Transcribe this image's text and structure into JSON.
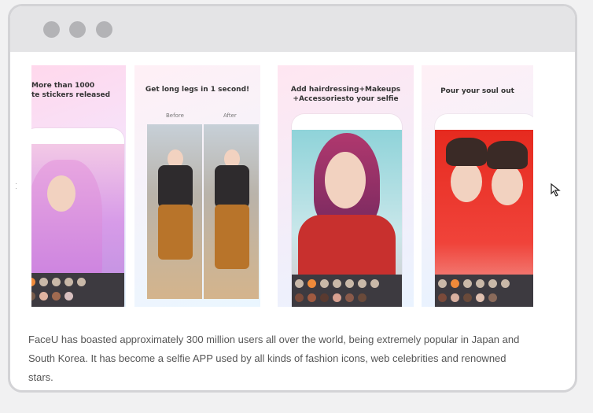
{
  "window": {
    "controls": [
      "window-dot",
      "window-dot",
      "window-dot"
    ]
  },
  "gallery": {
    "cards": [
      {
        "caption_line1": "More than 1000",
        "caption_line2": "te stickers released"
      },
      {
        "caption": "Get long legs in 1 second!",
        "before_label": "Before",
        "after_label": "After"
      },
      {
        "caption_line1": "Add hairdressing+Makeups",
        "caption_line2": "+Accessoriesto your selfie"
      },
      {
        "caption": "Pour your soul out"
      }
    ]
  },
  "description": {
    "text": "FaceU has boasted approximately 300 million users all over the world, being extremely popular in Japan and South Korea. It has become a selfie APP used by all kinds of fashion icons, web celebrities and renowned stars."
  },
  "colors": {
    "window_border": "#d3d3d6",
    "titlebar": "#e4e4e6",
    "dot": "#b3b3b6",
    "text": "#555555"
  }
}
